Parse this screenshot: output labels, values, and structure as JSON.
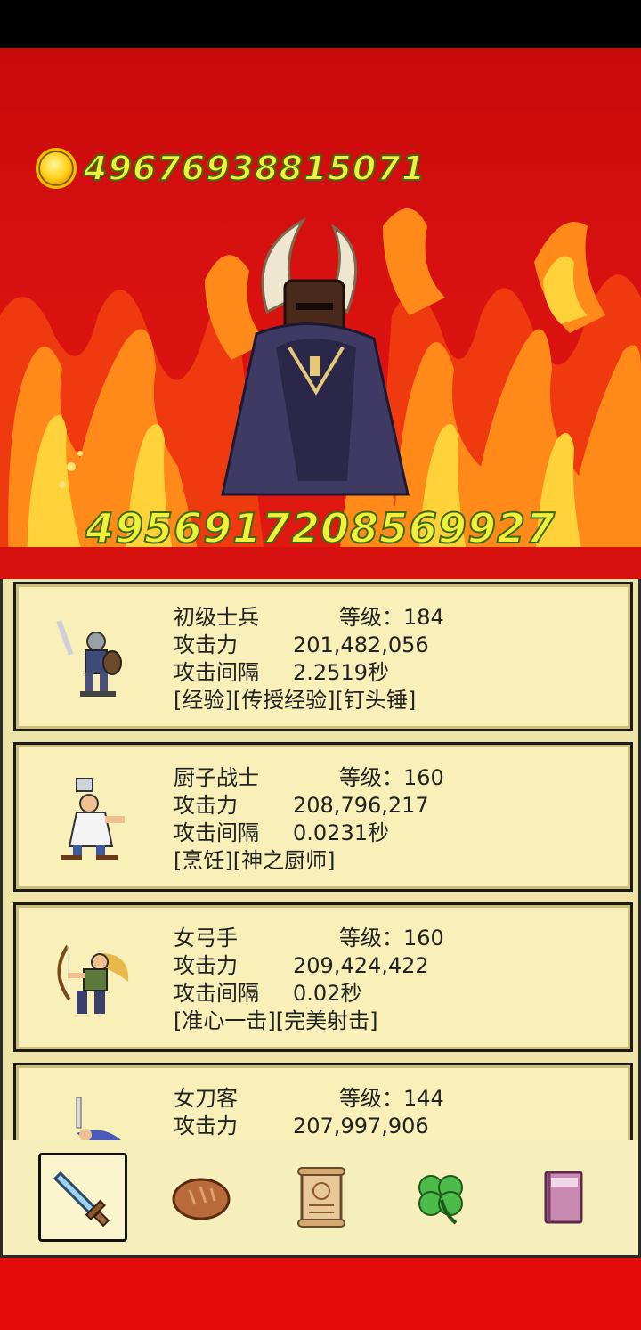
{
  "gold": {
    "amount": "49676938815071",
    "icon": "gold-coin-icon"
  },
  "boss": {
    "hp": "4956917208569927",
    "sprite": "horned-cloaked-boss"
  },
  "heroes": [
    {
      "name": "初级士兵",
      "level_label": "等级：184",
      "attack_label": "攻击力",
      "attack": "201,482,056",
      "interval_label": "攻击间隔",
      "interval": "2.2519秒",
      "skills": "[经验][传授经验][钉头锤]",
      "icon": "soldier-icon"
    },
    {
      "name": "厨子战士",
      "level_label": "等级：160",
      "attack_label": "攻击力",
      "attack": "208,796,217",
      "interval_label": "攻击间隔",
      "interval": "0.0231秒",
      "skills": "[烹饪][神之厨师]",
      "icon": "chef-warrior-icon"
    },
    {
      "name": "女弓手",
      "level_label": "等级：160",
      "attack_label": "攻击力",
      "attack": "209,424,422",
      "interval_label": "攻击间隔",
      "interval": "0.02秒",
      "skills": "[准心一击][完美射击]",
      "icon": "archer-icon"
    },
    {
      "name": "女刀客",
      "level_label": "等级：144",
      "attack_label": "攻击力",
      "attack": "207,997,906",
      "icon": "swordswoman-icon"
    }
  ],
  "tabs": [
    {
      "icon": "sword-icon",
      "selected": true
    },
    {
      "icon": "bread-icon",
      "selected": false
    },
    {
      "icon": "scroll-icon",
      "selected": false
    },
    {
      "icon": "clover-icon",
      "selected": false
    },
    {
      "icon": "book-icon",
      "selected": false
    }
  ]
}
